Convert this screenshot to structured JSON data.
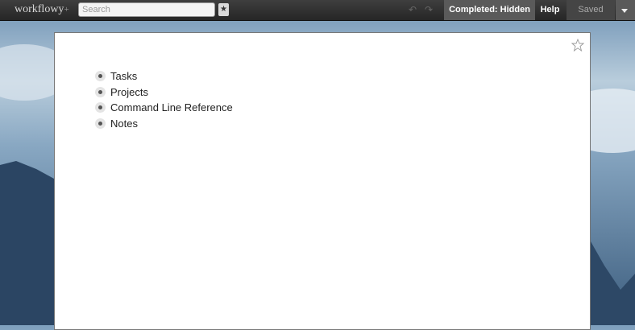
{
  "app": {
    "logo": "workflowy",
    "logo_plus": "+"
  },
  "search": {
    "placeholder": "Search",
    "value": ""
  },
  "toolbar": {
    "star_icon": "star-icon",
    "undo_icon": "undo-icon",
    "redo_icon": "redo-icon",
    "completed_label": "Completed: Hidden",
    "help_label": "Help",
    "saved_label": "Saved",
    "menu_icon": "chevron-down-icon"
  },
  "page": {
    "star_icon": "star-outline-icon",
    "items": [
      {
        "label": "Tasks"
      },
      {
        "label": "Projects"
      },
      {
        "label": "Command Line Reference"
      },
      {
        "label": "Notes"
      }
    ]
  },
  "colors": {
    "topbar": "#2f2f2f",
    "completed_bg": "#5a5a5a",
    "page_bg": "#ffffff"
  }
}
